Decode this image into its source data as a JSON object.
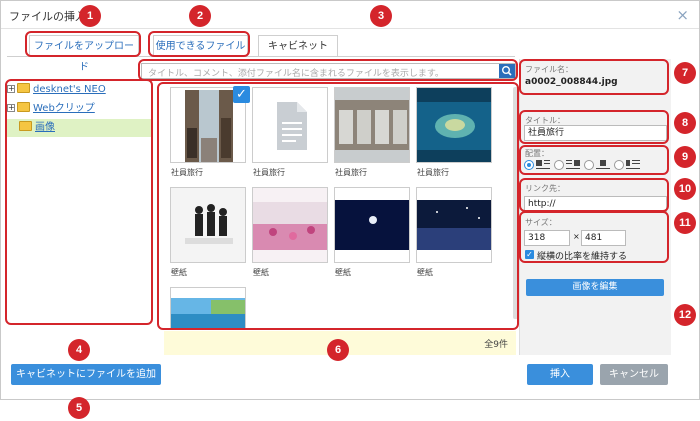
{
  "dialog": {
    "title": "ファイルの挿入",
    "close_glyph": "×"
  },
  "tabs": [
    {
      "label": "ファイルをアップロード"
    },
    {
      "label": "使用できるファイル"
    },
    {
      "label": "キャビネット",
      "active": true
    }
  ],
  "search": {
    "placeholder": "タイトル、コメント、添付ファイル名に含まれるファイルを表示します。",
    "icon": "search-icon"
  },
  "tree": {
    "items": [
      {
        "label": "desknet's NEO",
        "expandable": true,
        "expand_glyph": "+"
      },
      {
        "label": "Webクリップ",
        "expandable": true,
        "expand_glyph": "+"
      },
      {
        "label": "画像",
        "expandable": false,
        "selected": true
      }
    ]
  },
  "files": [
    {
      "caption": "社員旅行",
      "selected": true,
      "kind": "photo-alley"
    },
    {
      "caption": "社員旅行",
      "selected": false,
      "kind": "document-icon"
    },
    {
      "caption": "社員旅行",
      "selected": false,
      "kind": "photo-tanks"
    },
    {
      "caption": "社員旅行",
      "selected": false,
      "kind": "photo-island"
    },
    {
      "caption": "壁紙",
      "selected": false,
      "kind": "photo-people"
    },
    {
      "caption": "壁紙",
      "selected": false,
      "kind": "photo-flowers"
    },
    {
      "caption": "壁紙",
      "selected": false,
      "kind": "photo-moon"
    },
    {
      "caption": "壁紙",
      "selected": false,
      "kind": "photo-nightsky"
    },
    {
      "caption": "",
      "selected": false,
      "kind": "photo-beach"
    }
  ],
  "check_glyph": "✓",
  "file_count": "全9件",
  "details": {
    "filename_label": "ファイル名：",
    "filename": "a0002_008844.jpg",
    "title_label": "タイトル：",
    "title_value": "社員旅行",
    "align_label": "配置：",
    "link_label": "リンク先：",
    "link_value": "http://",
    "size_label": "サイズ：",
    "width": "318",
    "height": "481",
    "size_sep": "×",
    "keep_ratio_label": "縦横の比率を維持する",
    "edit_button": "画像を編集"
  },
  "buttons": {
    "add_to_cabinet": "キャビネットにファイルを追加",
    "insert": "挿入",
    "cancel": "キャンセル"
  },
  "badges": [
    "1",
    "2",
    "3",
    "4",
    "5",
    "6",
    "7",
    "8",
    "9",
    "10",
    "11",
    "12"
  ],
  "colors": {
    "accent": "#2a8be0",
    "link": "#2a6ebb",
    "callout": "#d4252b",
    "selected_row": "#dff2c4",
    "count_bar": "#fefbd9"
  }
}
